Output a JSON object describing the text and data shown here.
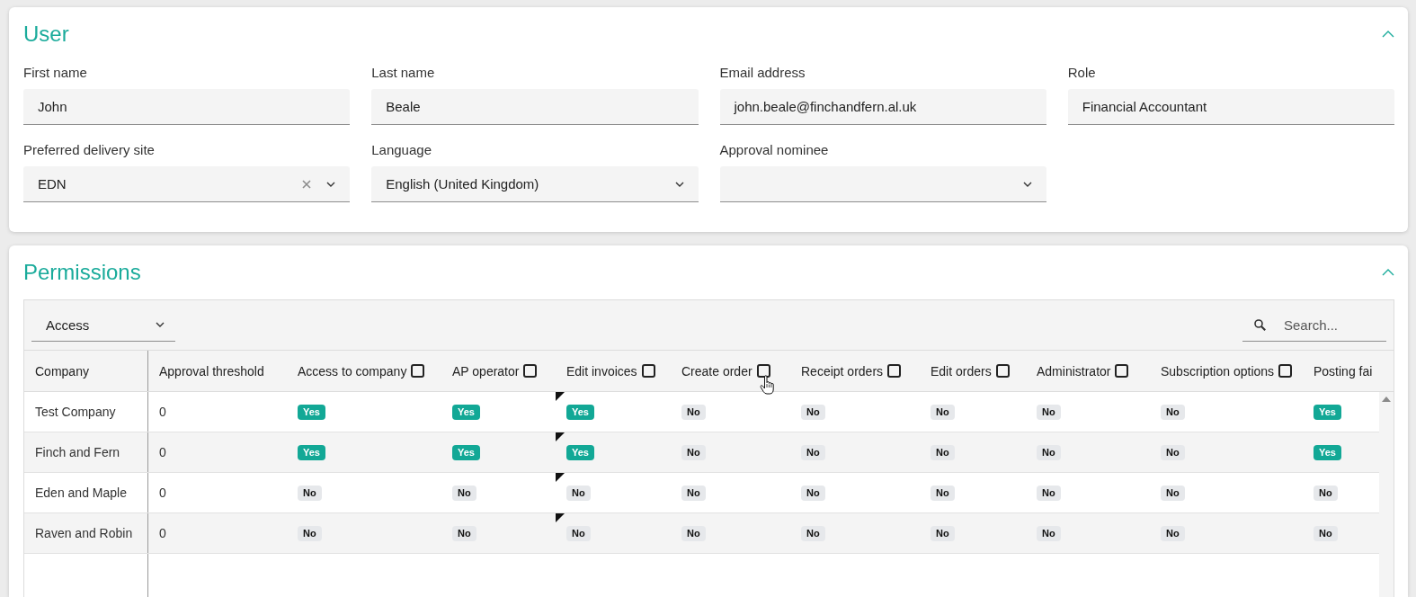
{
  "user_panel": {
    "title": "User",
    "expanded": true,
    "fields": [
      {
        "label": "First name",
        "kind": "text",
        "value": "John"
      },
      {
        "label": "Last name",
        "kind": "text",
        "value": "Beale"
      },
      {
        "label": "Email address",
        "kind": "text",
        "value": "john.beale@finchandfern.al.uk"
      },
      {
        "label": "Role",
        "kind": "text",
        "value": "Financial Accountant"
      },
      {
        "label": "Preferred delivery site",
        "kind": "select",
        "value": "EDN",
        "clearable": true
      },
      {
        "label": "Language",
        "kind": "select",
        "value": "English (United Kingdom)",
        "clearable": false
      },
      {
        "label": "Approval nominee",
        "kind": "select",
        "clearable": false
      }
    ]
  },
  "permissions_panel": {
    "title": "Permissions",
    "expanded": true,
    "view_select": {
      "value": "Access"
    },
    "search": {
      "placeholder": "Search..."
    },
    "table": {
      "columns": [
        {
          "label": "Company",
          "kind": "text"
        },
        {
          "label": "Approval threshold",
          "kind": "number"
        },
        {
          "label": "Access to company",
          "kind": "badge",
          "select_all": {
            "checked": false,
            "hovered": false
          },
          "corner_mark": false
        },
        {
          "label": "AP operator",
          "kind": "badge",
          "select_all": {
            "checked": false,
            "hovered": false
          },
          "corner_mark": false
        },
        {
          "label": "Edit invoices",
          "kind": "badge",
          "select_all": {
            "checked": false,
            "hovered": false
          },
          "corner_mark": true
        },
        {
          "label": "Create order",
          "kind": "badge",
          "select_all": {
            "checked": false,
            "hovered": true
          },
          "corner_mark": false
        },
        {
          "label": "Receipt orders",
          "kind": "badge",
          "select_all": {
            "checked": false,
            "hovered": false
          },
          "corner_mark": false
        },
        {
          "label": "Edit orders",
          "kind": "badge",
          "select_all": {
            "checked": false,
            "hovered": false
          },
          "corner_mark": false
        },
        {
          "label": "Administrator",
          "kind": "badge",
          "select_all": {
            "checked": false,
            "hovered": false
          },
          "corner_mark": false
        },
        {
          "label": "Subscription options",
          "kind": "badge",
          "select_all": {
            "checked": false,
            "hovered": false
          },
          "corner_mark": false
        },
        {
          "label": "Posting fai",
          "kind": "badge",
          "corner_mark": false
        }
      ],
      "rows": [
        {
          "cells": [
            {
              "text": "Test Company"
            },
            {
              "text": "0"
            },
            {
              "text": "Yes",
              "on": true
            },
            {
              "text": "Yes",
              "on": true
            },
            {
              "text": "Yes",
              "on": true
            },
            {
              "text": "No",
              "on": false
            },
            {
              "text": "No",
              "on": false
            },
            {
              "text": "No",
              "on": false
            },
            {
              "text": "No",
              "on": false
            },
            {
              "text": "No",
              "on": false
            },
            {
              "text": "Yes",
              "on": true
            }
          ]
        },
        {
          "cells": [
            {
              "text": "Finch and Fern"
            },
            {
              "text": "0"
            },
            {
              "text": "Yes",
              "on": true
            },
            {
              "text": "Yes",
              "on": true
            },
            {
              "text": "Yes",
              "on": true
            },
            {
              "text": "No",
              "on": false
            },
            {
              "text": "No",
              "on": false
            },
            {
              "text": "No",
              "on": false
            },
            {
              "text": "No",
              "on": false
            },
            {
              "text": "No",
              "on": false
            },
            {
              "text": "Yes",
              "on": true
            }
          ]
        },
        {
          "cells": [
            {
              "text": "Eden and Maple"
            },
            {
              "text": "0"
            },
            {
              "text": "No",
              "on": false
            },
            {
              "text": "No",
              "on": false
            },
            {
              "text": "No",
              "on": false
            },
            {
              "text": "No",
              "on": false
            },
            {
              "text": "No",
              "on": false
            },
            {
              "text": "No",
              "on": false
            },
            {
              "text": "No",
              "on": false
            },
            {
              "text": "No",
              "on": false
            },
            {
              "text": "No",
              "on": false
            }
          ]
        },
        {
          "cells": [
            {
              "text": "Raven and Robin"
            },
            {
              "text": "0"
            },
            {
              "text": "No",
              "on": false
            },
            {
              "text": "No",
              "on": false
            },
            {
              "text": "No",
              "on": false
            },
            {
              "text": "No",
              "on": false
            },
            {
              "text": "No",
              "on": false
            },
            {
              "text": "No",
              "on": false
            },
            {
              "text": "No",
              "on": false
            },
            {
              "text": "No",
              "on": false
            },
            {
              "text": "No",
              "on": false
            }
          ]
        }
      ]
    }
  }
}
